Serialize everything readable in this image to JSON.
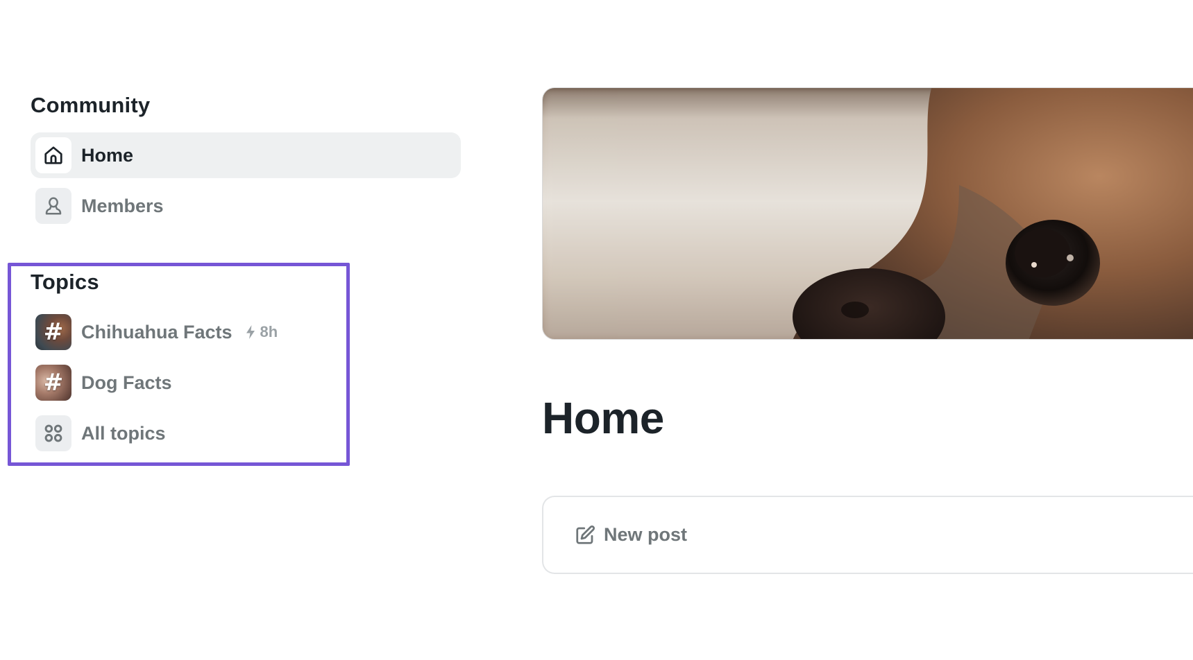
{
  "sidebar": {
    "community_heading": "Community",
    "nav": [
      {
        "label": "Home",
        "icon": "home-icon",
        "active": true
      },
      {
        "label": "Members",
        "icon": "user-icon",
        "active": false
      }
    ],
    "topics_heading": "Topics",
    "topics": [
      {
        "label": "Chihuahua Facts",
        "icon": "hashtag-icon",
        "activity_icon": "lightning-icon",
        "activity": "8h"
      },
      {
        "label": "Dog Facts",
        "icon": "hashtag-icon"
      },
      {
        "label": "All topics",
        "icon": "grid-icon"
      }
    ],
    "highlight_color": "#7656d6"
  },
  "main": {
    "banner_image": "chihuahua-closeup-photo",
    "title": "Home",
    "composer": {
      "label": "New post",
      "icon": "edit-icon"
    }
  },
  "colors": {
    "text_dark": "#1c2329",
    "text_muted": "#6f7679",
    "active_bg": "#eef0f1"
  }
}
